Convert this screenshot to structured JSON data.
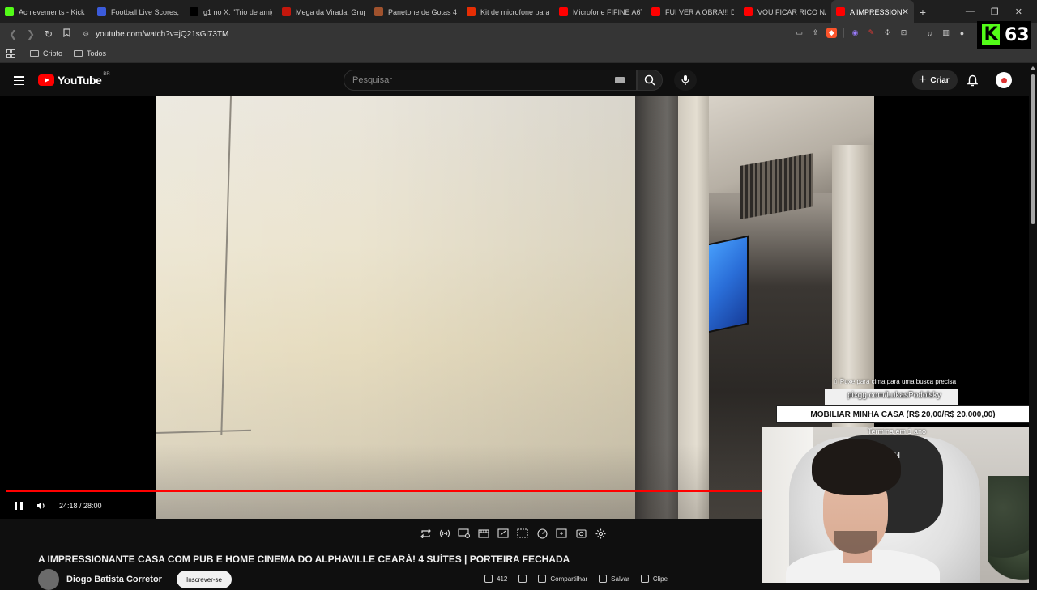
{
  "browser": {
    "tabs": [
      {
        "title": "Achievements - Kick D",
        "favicon": "kick-icon",
        "color": "#53fc18",
        "active": false
      },
      {
        "title": "Football Live Scores, F",
        "favicon": "football-icon",
        "color": "#3b5bdb",
        "active": false
      },
      {
        "title": "g1 no X: \"Trio de amig",
        "favicon": "x-icon",
        "color": "#000000",
        "active": false
      },
      {
        "title": "Mega da Virada: Grupo",
        "favicon": "g1-icon",
        "color": "#c4170c",
        "active": false
      },
      {
        "title": "Panetone de Gotas 45",
        "favicon": "store-icon",
        "color": "#a0522d",
        "active": false
      },
      {
        "title": "Kit de microfone para",
        "favicon": "aliexpress-icon",
        "color": "#e62e04",
        "active": false
      },
      {
        "title": "Microfone FIFINE A6T",
        "favicon": "youtube-icon",
        "color": "#ff0000",
        "active": false
      },
      {
        "title": "FUI VER A OBRA!!! DA",
        "favicon": "youtube-icon",
        "color": "#ff0000",
        "active": false
      },
      {
        "title": "VOU FICAR RICO NA R",
        "favicon": "youtube-icon",
        "color": "#ff0000",
        "active": false
      },
      {
        "title": "A IMPRESSION",
        "favicon": "youtube-icon",
        "color": "#ff0000",
        "active": true
      }
    ],
    "url": "youtube.com/watch?v=jQ21sGl73TM",
    "bookmarks": [
      "Cripto",
      "Todos"
    ]
  },
  "kick_widget": {
    "count": "63",
    "accent": "#53fc18"
  },
  "youtube": {
    "logo_text": "YouTube",
    "country_code": "BR",
    "search_placeholder": "Pesquisar",
    "create_label": "Criar"
  },
  "player": {
    "current_time": "24:18",
    "duration": "28:00",
    "time_display": "24:18 / 28:00",
    "progress_fraction": 0.868,
    "progress_color": "#ff0000"
  },
  "video": {
    "title": "A IMPRESSIONANTE CASA COM PUB E HOME CINEMA DO ALPHAVILLE CEARÁ! 4 SUÍTES | PORTEIRA FECHADA",
    "channel_name": "Diogo Batista Corretor",
    "join_label": "Inscrever-se",
    "like_count": "412",
    "share_label": "Compartilhar",
    "save_label": "Salvar",
    "clip_label": "Clipe"
  },
  "stream_overlay": {
    "hint": "⇧ Puxe para cima para uma busca precisa",
    "link": "pixgg.com/LukasPodolsky",
    "goal": "MOBILIAR MINHA CASA (R$ 20,00/R$ 20.000,00)",
    "ends": "Termina em 1 ano"
  },
  "webcam": {
    "shirt_logo": "YM"
  }
}
